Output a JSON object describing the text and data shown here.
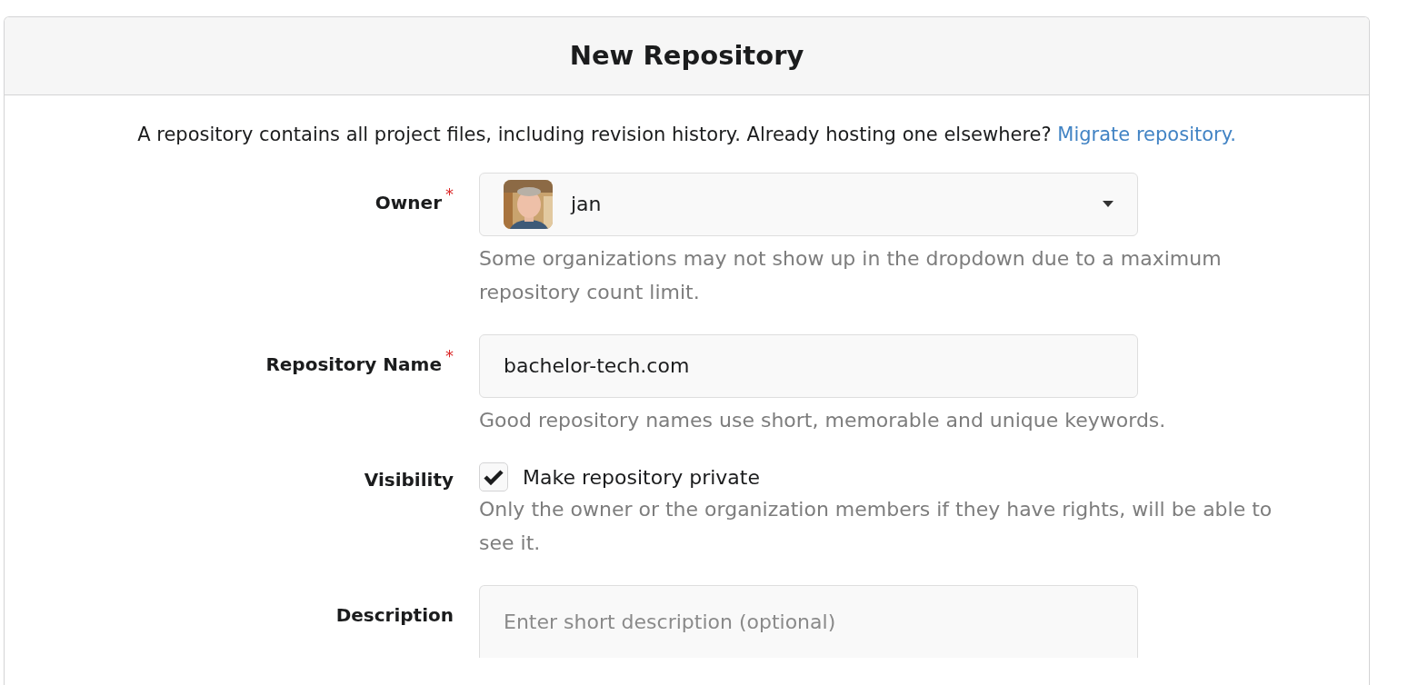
{
  "header": {
    "title": "New Repository"
  },
  "intro": {
    "text": "A repository contains all project files, including revision history. Already hosting one elsewhere?",
    "link": "Migrate repository."
  },
  "fields": [
    {
      "kind": "select",
      "label": "Owner",
      "required_mark": "*",
      "value": "jan",
      "help": "Some organizations may not show up in the dropdown due to a maximum repository count limit."
    },
    {
      "kind": "text",
      "label": "Repository Name",
      "required_mark": "*",
      "value": "bachelor-tech.com",
      "help": "Good repository names use short, memorable and unique keywords."
    },
    {
      "kind": "checkbox",
      "label": "Visibility",
      "checked": true,
      "text": "Make repository private",
      "help": "Only the owner or the organization members if they have rights, will be able to see it."
    },
    {
      "kind": "textarea",
      "label": "Description",
      "placeholder": "Enter short description (optional)"
    }
  ]
}
